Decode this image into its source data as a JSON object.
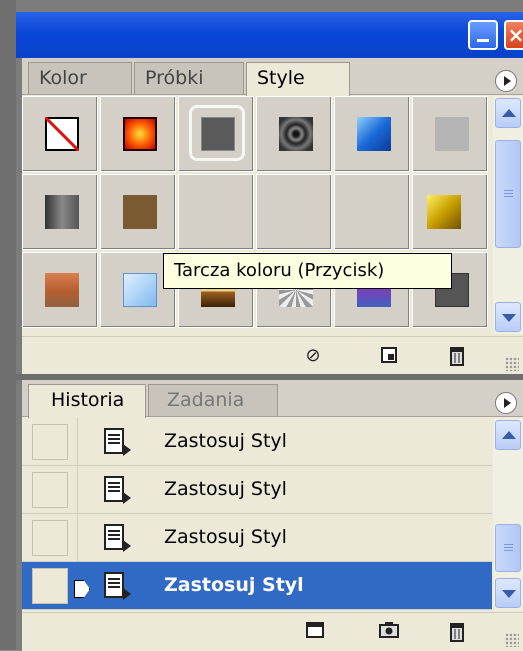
{
  "tabs_top": [
    {
      "label": "Kolor",
      "active": false
    },
    {
      "label": "Próbki",
      "active": false
    },
    {
      "label": "Style",
      "active": true
    }
  ],
  "tooltip": "Tarcza koloru (Przycisk)",
  "styles": [
    {
      "name": "none-style"
    },
    {
      "name": "red-glow-style"
    },
    {
      "name": "gray-inset-style"
    },
    {
      "name": "dark-ring-style"
    },
    {
      "name": "blue-glass-style"
    },
    {
      "name": "light-gray-style"
    },
    {
      "name": "gray-gradient-style"
    },
    {
      "name": "brown-style"
    },
    {
      "name": "hidden-style-a"
    },
    {
      "name": "hidden-style-b"
    },
    {
      "name": "hidden-style-c"
    },
    {
      "name": "gold-style"
    },
    {
      "name": "sunset-style"
    },
    {
      "name": "light-blue-style"
    },
    {
      "name": "landscape-style"
    },
    {
      "name": "noise-texture-style"
    },
    {
      "name": "purple-bevel-style"
    },
    {
      "name": "dark-gray-style"
    }
  ],
  "tabs_bottom": [
    {
      "label": "Historia",
      "active": true
    },
    {
      "label": "Zadania",
      "active": false
    }
  ],
  "history": [
    {
      "label": "Zastosuj Styl",
      "selected": false
    },
    {
      "label": "Zastosuj Styl",
      "selected": false
    },
    {
      "label": "Zastosuj Styl",
      "selected": false
    },
    {
      "label": "Zastosuj Styl",
      "selected": true
    }
  ],
  "colors": {
    "titlebar": "#0a46d8",
    "selection": "#316ac5",
    "panel": "#ece9d8"
  }
}
